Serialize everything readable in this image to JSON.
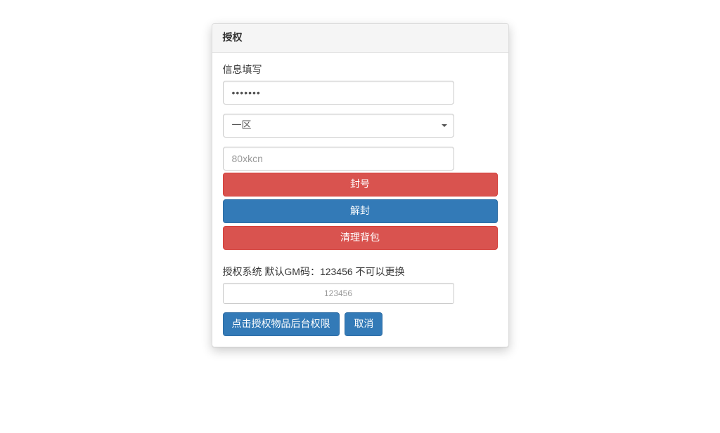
{
  "panel": {
    "title": "授权"
  },
  "form": {
    "info_label": "信息填写",
    "password_value": "1111111",
    "select_value": "一区",
    "username_placeholder": "80xkcn"
  },
  "actions": {
    "ban": "封号",
    "unban": "解封",
    "clear_bag": "清理背包"
  },
  "auth": {
    "label": "授权系统 默认GM码：123456 不可以更换",
    "gm_placeholder": "123456",
    "authorize_btn": "点击授权物品后台权限",
    "cancel_btn": "取消"
  }
}
